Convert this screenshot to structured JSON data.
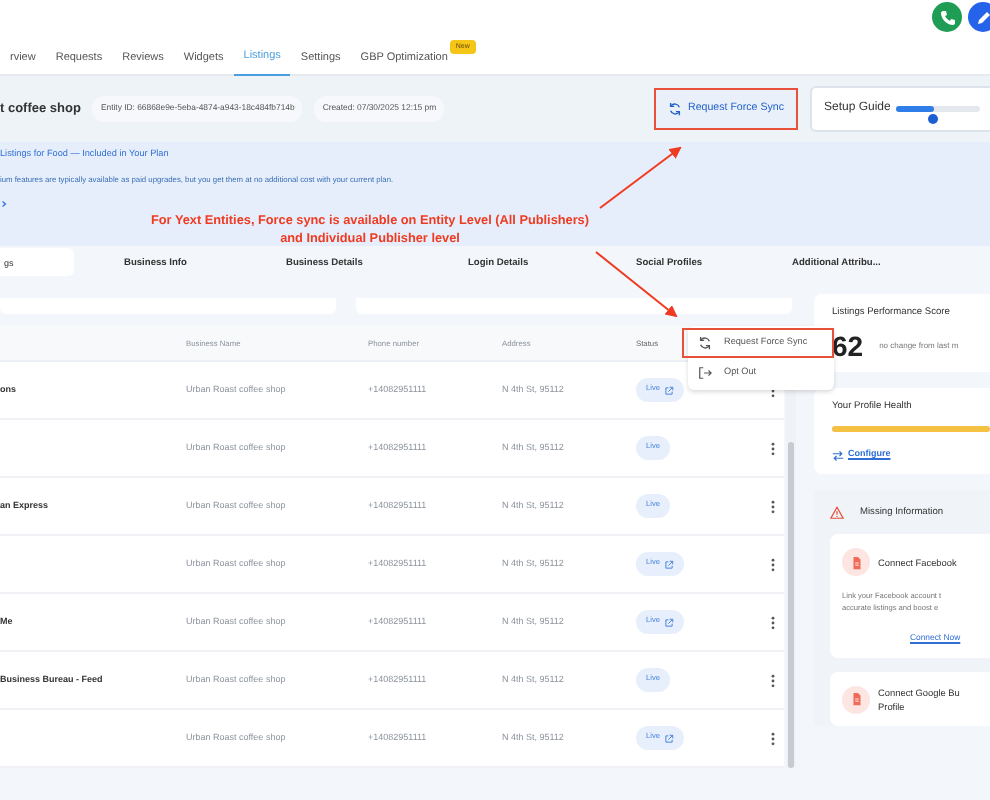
{
  "nav_tabs": [
    {
      "label": "rview",
      "selected": false
    },
    {
      "label": "Requests",
      "selected": false
    },
    {
      "label": "Reviews",
      "selected": false
    },
    {
      "label": "Widgets",
      "selected": false
    },
    {
      "label": "Listings",
      "selected": true
    },
    {
      "label": "Settings",
      "selected": false
    },
    {
      "label": "GBP Optimization",
      "selected": false,
      "badge": "New"
    }
  ],
  "entity": {
    "name": "t coffee shop",
    "entity_id": "Entity ID: 66868e9e-5eba-4874-a943-18c484fb714b",
    "created": "Created: 07/30/2025 12:15 pm"
  },
  "force_sync_button": "Request Force Sync",
  "setup_guide": {
    "label": "Setup Guide",
    "level": 0.45
  },
  "banner": {
    "title": "Listings for Food — Included in Your Plan",
    "text": "ium features are typically available as paid upgrades, but you get them at no additional cost with your current plan."
  },
  "annotation": {
    "lines": [
      "For Yext Entities, Force sync is available on Entity Level (All Publishers)",
      "and Individual Publisher level"
    ]
  },
  "section_tabs": {
    "search_value": "gs",
    "tabs": [
      "Business Info",
      "Business Details",
      "Login Details",
      "Social Profiles",
      "Additional Attribu..."
    ]
  },
  "table": {
    "columns": [
      "Business Name",
      "Phone number",
      "Address",
      "Status"
    ],
    "rows": [
      {
        "publisher": "ons",
        "business_name": "Urban Roast coffee shop",
        "phone": "+14082951111",
        "address": "N 4th St, 95112",
        "status": "Live",
        "external_link": true
      },
      {
        "publisher": "",
        "business_name": "Urban Roast coffee shop",
        "phone": "+14082951111",
        "address": "N 4th St, 95112",
        "status": "Live",
        "external_link": false
      },
      {
        "publisher": "an Express",
        "business_name": "Urban Roast coffee shop",
        "phone": "+14082951111",
        "address": "N 4th St, 95112",
        "status": "Live",
        "external_link": false
      },
      {
        "publisher": "",
        "business_name": "Urban Roast coffee shop",
        "phone": "+14082951111",
        "address": "N 4th St, 95112",
        "status": "Live",
        "external_link": true
      },
      {
        "publisher": "Me",
        "business_name": "Urban Roast coffee shop",
        "phone": "+14082951111",
        "address": "N 4th St, 95112",
        "status": "Live",
        "external_link": true
      },
      {
        "publisher": "Business Bureau - Feed",
        "business_name": "Urban Roast coffee shop",
        "phone": "+14082951111",
        "address": "N 4th St, 95112",
        "status": "Live",
        "external_link": false
      },
      {
        "publisher": "",
        "business_name": "Urban Roast coffee shop",
        "phone": "+14082951111",
        "address": "N 4th St, 95112",
        "status": "Live",
        "external_link": true
      }
    ]
  },
  "row_menu": {
    "items": [
      {
        "kind": "sync",
        "label": "Request Force Sync",
        "highlighted": true
      },
      {
        "kind": "opt-out",
        "label": "Opt Out",
        "highlighted": false
      }
    ]
  },
  "score": {
    "title": "Listings Performance Score",
    "value": "62",
    "change": "no change from last m"
  },
  "profile_health": {
    "title": "Your Profile Health",
    "level": 1,
    "link": "Configure"
  },
  "missing": {
    "title": "Missing Information",
    "cards": [
      {
        "title_lines": [
          "Connect Facebook"
        ],
        "text_lines": [
          "Link your Facebook account t",
          "accurate listings and boost e"
        ],
        "action": "Connect Now"
      },
      {
        "title_lines": [
          "Connect Google Bu",
          "Profile"
        ]
      }
    ]
  }
}
